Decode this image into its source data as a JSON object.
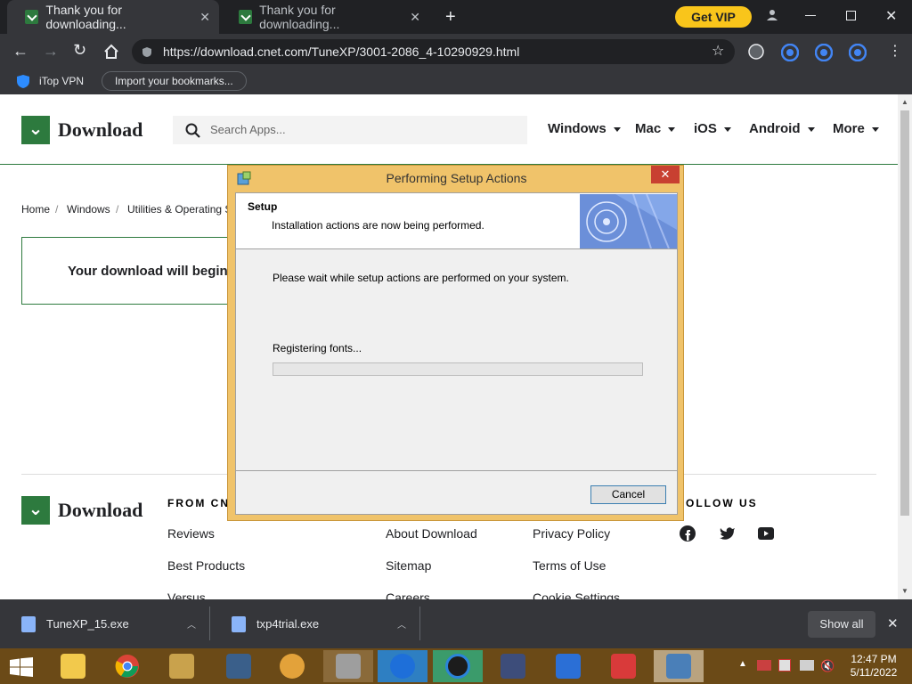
{
  "browser": {
    "tabs": [
      {
        "title": "Thank you for downloading...",
        "active": true
      },
      {
        "title": "Thank you for downloading...",
        "active": false
      }
    ],
    "get_vip": "Get VIP",
    "url": "https://download.cnet.com/TuneXP/3001-2086_4-10290929.html",
    "bookmarks": [
      "iTop VPN",
      "Import your bookmarks..."
    ]
  },
  "site": {
    "logo_text": "Download",
    "search_placeholder": "Search Apps...",
    "nav": [
      "Windows",
      "Mac",
      "iOS",
      "Android",
      "More"
    ],
    "breadcrumb": [
      "Home",
      "Windows",
      "Utilities & Operating S"
    ],
    "download_message": "Your download will begin",
    "footer": {
      "from_cnet": "FROM CN",
      "follow_us": "OLLOW US",
      "col1": [
        "Reviews",
        "Best Products",
        "Versus"
      ],
      "col2": [
        "About Download",
        "Sitemap",
        "Careers"
      ],
      "col3": [
        "Privacy Policy",
        "Terms of Use",
        "Cookie Settings"
      ]
    }
  },
  "dialog": {
    "title": "Performing Setup Actions",
    "close": "✕",
    "header_title": "Setup",
    "header_subtitle": "Installation actions are now being performed.",
    "body_text": "Please wait while setup actions are performed on your system.",
    "status": "Registering fonts...",
    "progress": 0,
    "cancel": "Cancel"
  },
  "downloads": {
    "items": [
      "TuneXP_15.exe",
      "txp4trial.exe"
    ],
    "show_all": "Show all"
  },
  "taskbar": {
    "time": "12:47 PM",
    "date": "5/11/2022"
  }
}
